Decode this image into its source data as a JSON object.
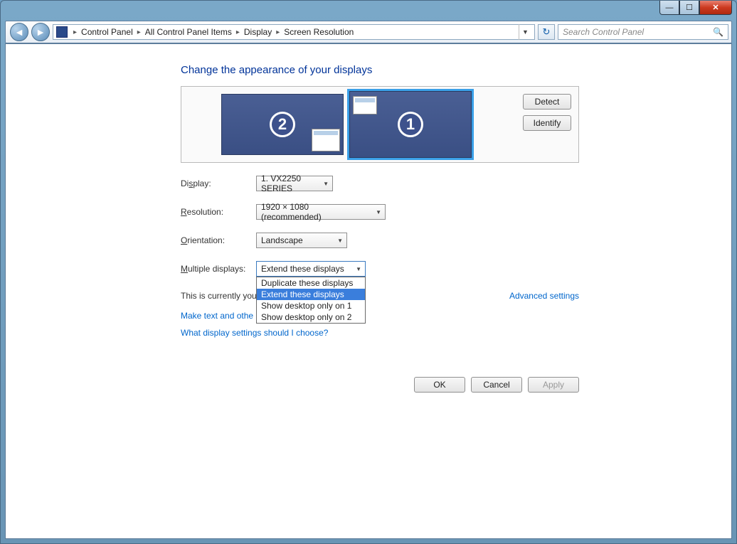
{
  "titlebar": {
    "min": "—",
    "max": "☐",
    "close": "✕"
  },
  "nav": {
    "breadcrumbs": [
      "Control Panel",
      "All Control Panel Items",
      "Display",
      "Screen Resolution"
    ],
    "search_placeholder": "Search Control Panel"
  },
  "page": {
    "heading": "Change the appearance of your displays",
    "detect": "Detect",
    "identify": "Identify",
    "monitors": {
      "primary": "1",
      "secondary": "2"
    },
    "labels": {
      "display": "Display:",
      "resolution": "Resolution:",
      "orientation": "Orientation:",
      "multiple": "Multiple displays:"
    },
    "values": {
      "display": "1. VX2250 SERIES",
      "resolution": "1920 × 1080  (recommended)",
      "orientation": "Landscape",
      "multiple": "Extend these displays"
    },
    "multiple_options": [
      "Duplicate these displays",
      "Extend these displays",
      "Show desktop only on 1",
      "Show desktop only on 2"
    ],
    "note": "This is currently you",
    "text_link": "Make text and othe",
    "settings_link": "What display settings should I choose?",
    "advanced": "Advanced settings",
    "ok": "OK",
    "cancel": "Cancel",
    "apply": "Apply"
  }
}
